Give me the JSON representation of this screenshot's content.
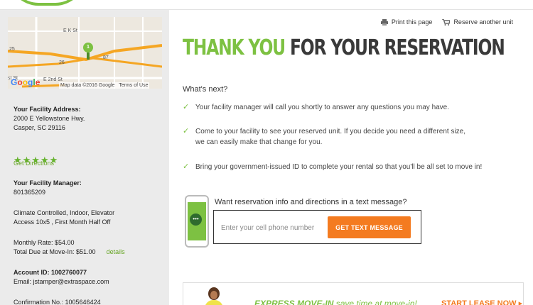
{
  "header": {
    "print_label": "Print this page",
    "reserve_label": "Reserve another unit"
  },
  "map": {
    "labels": {
      "street1": "E K St",
      "street2": "E 2nd St",
      "street3": "st St",
      "hwy26": "26",
      "hwy87": "87",
      "hwy25": "25",
      "pin": "1"
    },
    "google": [
      "G",
      "o",
      "o",
      "g",
      "l",
      "e"
    ],
    "attribution": "Map data ©2016 Google",
    "terms": "Terms of Use"
  },
  "facility": {
    "address_heading": "Your Facility Address:",
    "address_line1": "2000 E Yellowstone Hwy.",
    "address_line2": "Casper, SC 29116",
    "stars": "★★★★★",
    "rating": 5,
    "directions_label": "Get Directions",
    "manager_heading": "Your Facility Manager:",
    "manager_value": "801365209",
    "features": "Climate Controlled, Indoor, Elevator",
    "unit": "Access 10x5 , First Month Half Off",
    "monthly_rate": "Monthly Rate: $54.00",
    "total_due": "Total Due at Move-In: $51.00",
    "details_label": "details",
    "account_id": "Account ID: 1002760077",
    "email": "Email: jstamper@extraspace.com",
    "confirmation": "Confirmation No.: 1005646424"
  },
  "main": {
    "title_green": "THANK YOU",
    "title_dark": "FOR YOUR RESERVATION",
    "whats_next": "What's next?",
    "steps": [
      {
        "line1": "Your facility manager will call you shortly to answer any questions you may have.",
        "line2": ""
      },
      {
        "line1": "Come to your facility to see your reserved unit. If you decide you need a different size,",
        "line2": "we can easily make that change for you."
      },
      {
        "line1": "Bring your government-issued ID to complete your rental so that you'll be all set to move in!",
        "line2": ""
      }
    ],
    "check_glyph": "✓"
  },
  "sms": {
    "title": "Want reservation info and directions in a text message?",
    "placeholder": "Enter your cell phone number",
    "value": "",
    "button_label": "GET TEXT MESSAGE"
  },
  "banner": {
    "express_bold": "EXPRESS MOVE-IN",
    "express_sub": "save time at move-in!",
    "start_lease": "START LEASE NOW ▸"
  },
  "colors": {
    "brand_green": "#7dc142",
    "brand_orange": "#f47b20",
    "sidebar_bg": "#ebebeb"
  }
}
